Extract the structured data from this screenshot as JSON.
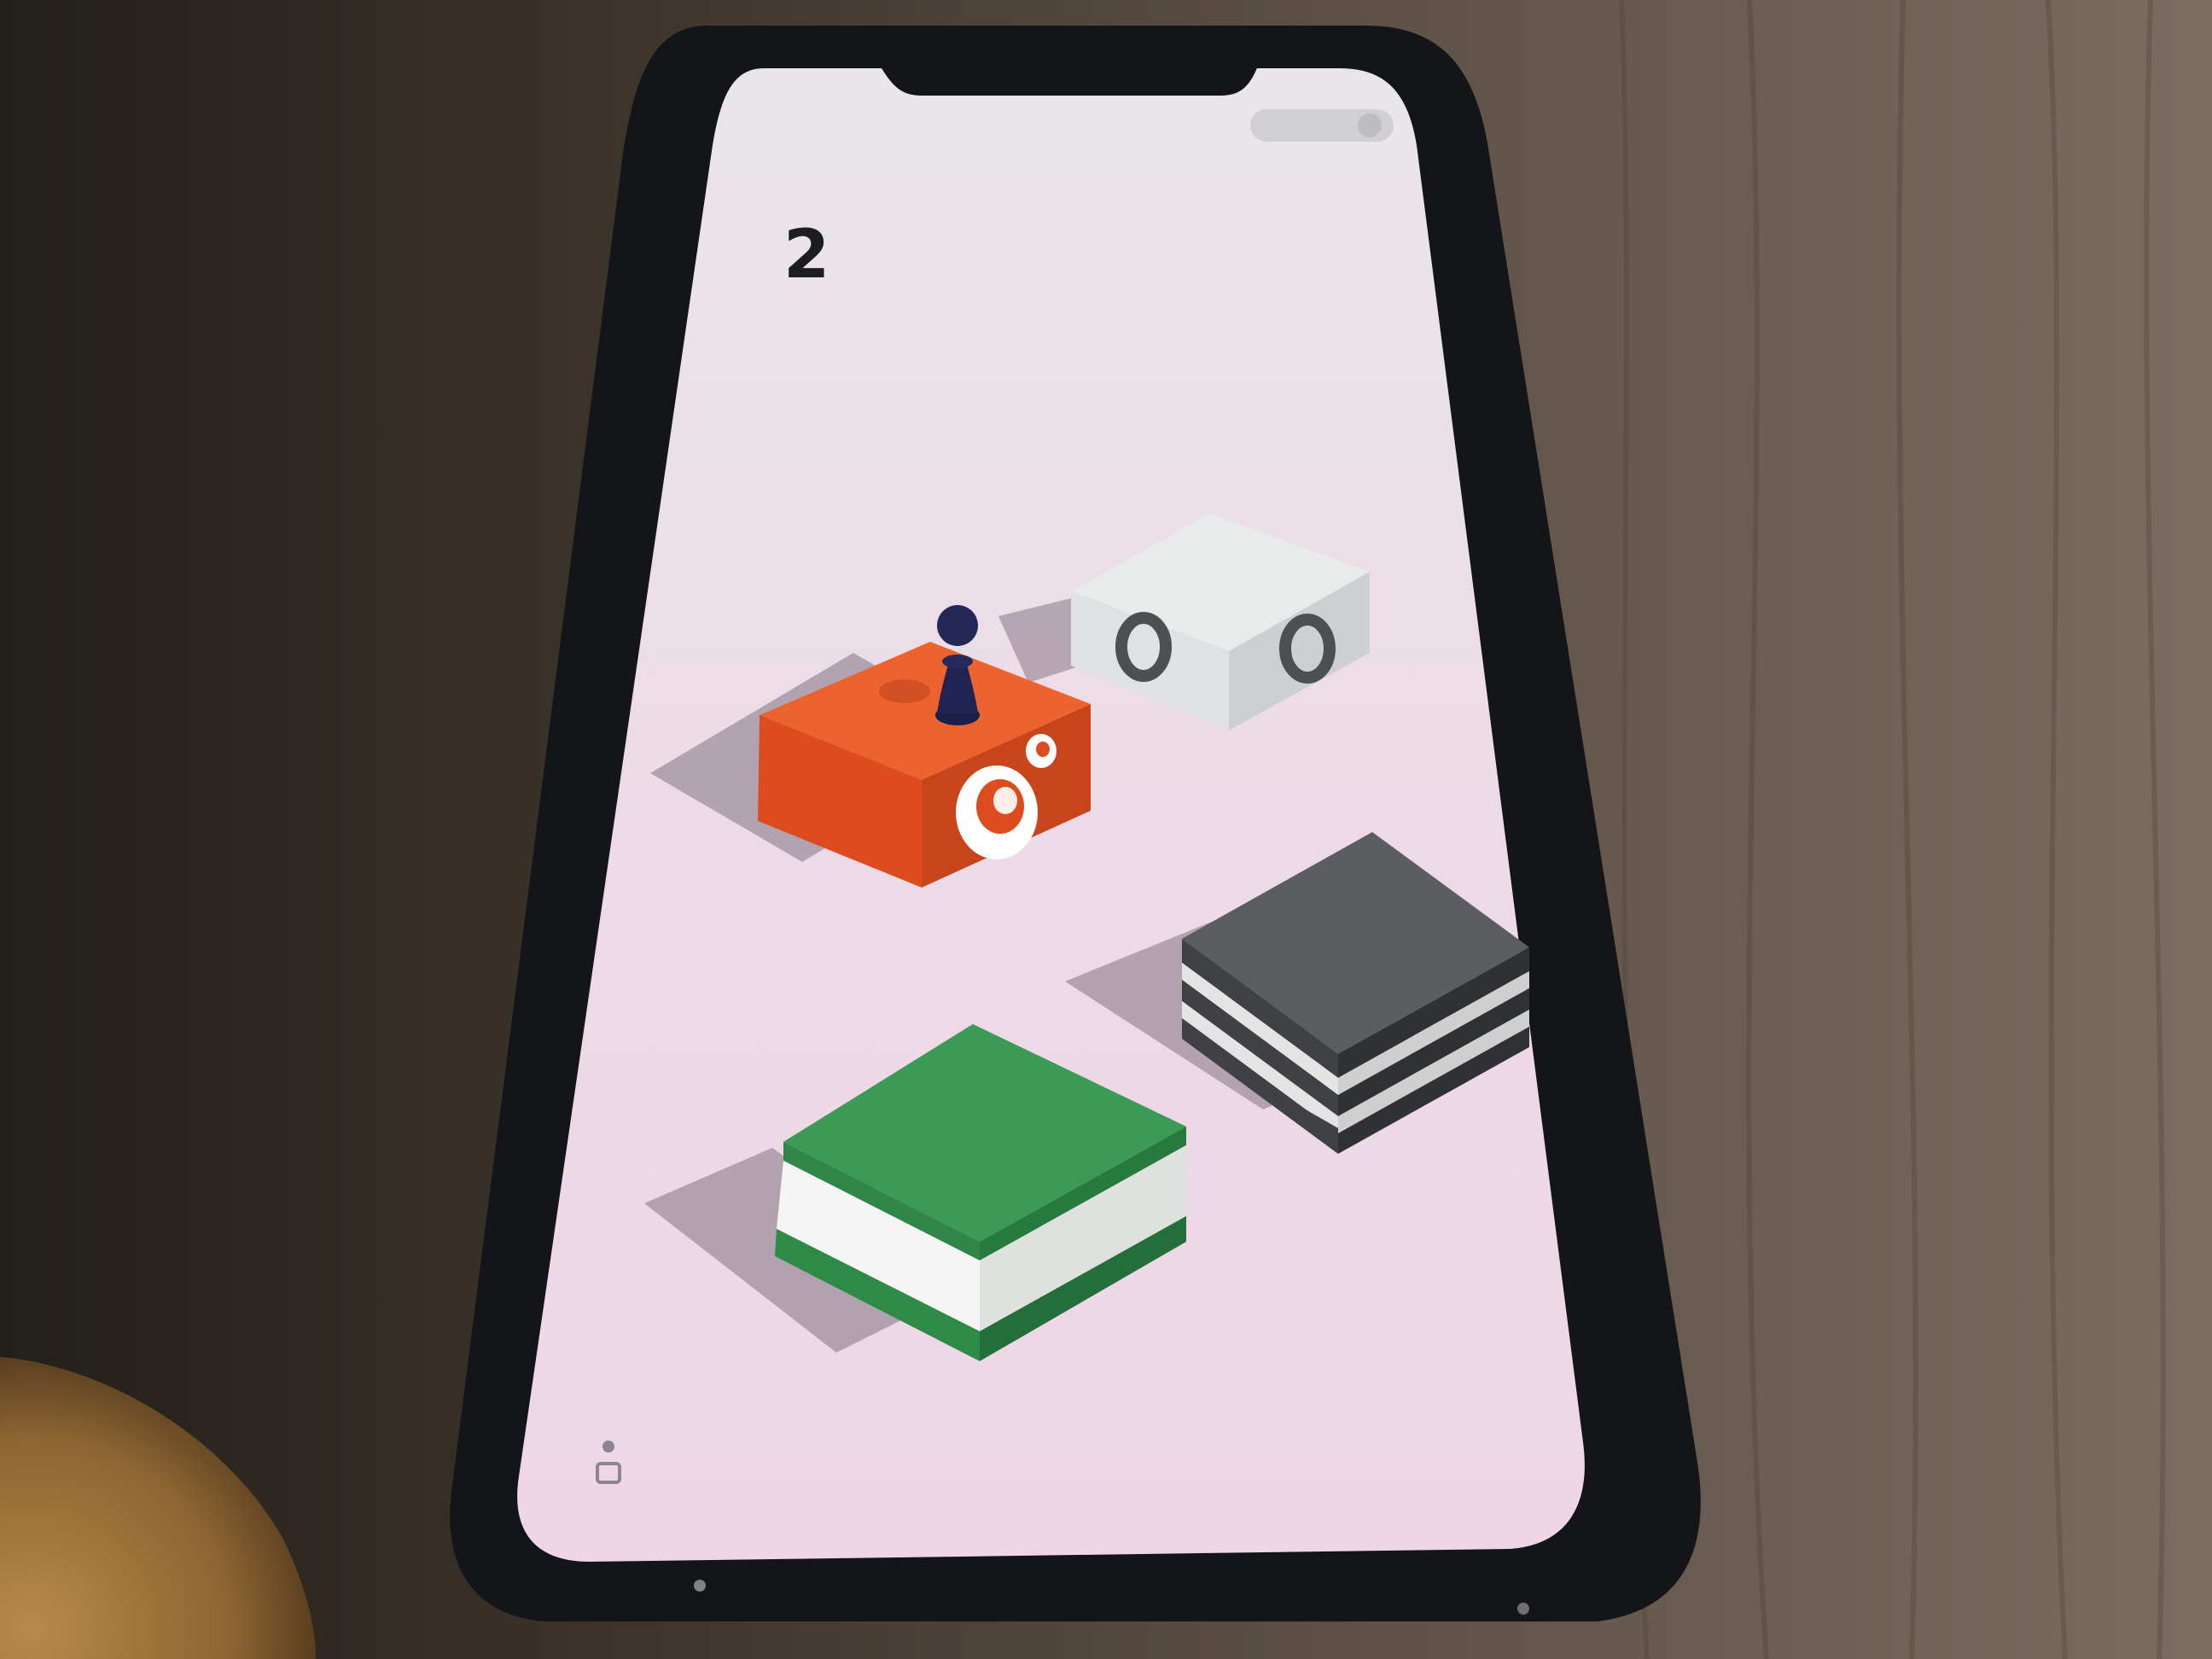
{
  "game": {
    "score": "2"
  },
  "colors": {
    "background_left": "#2b2621",
    "background_right": "#6b5f53",
    "phone_frame": "#16171b",
    "screen_top": "#e8e4ea",
    "screen_bottom": "#ebd7e6",
    "shadow": "#a99aa6",
    "orange_top": "#ea5f2f",
    "orange_front": "#d94a1e",
    "orange_side": "#b83a16",
    "white_top": "#e8eaea",
    "white_front": "#dcdedf",
    "white_side": "#c8cacb",
    "gray_top": "#5b5d60",
    "gray_side": "#3c3e41",
    "green_top": "#3a9a55",
    "green_side": "#2d7e44",
    "pawn": "#1f2450",
    "toggle": "#cfcfd2"
  }
}
